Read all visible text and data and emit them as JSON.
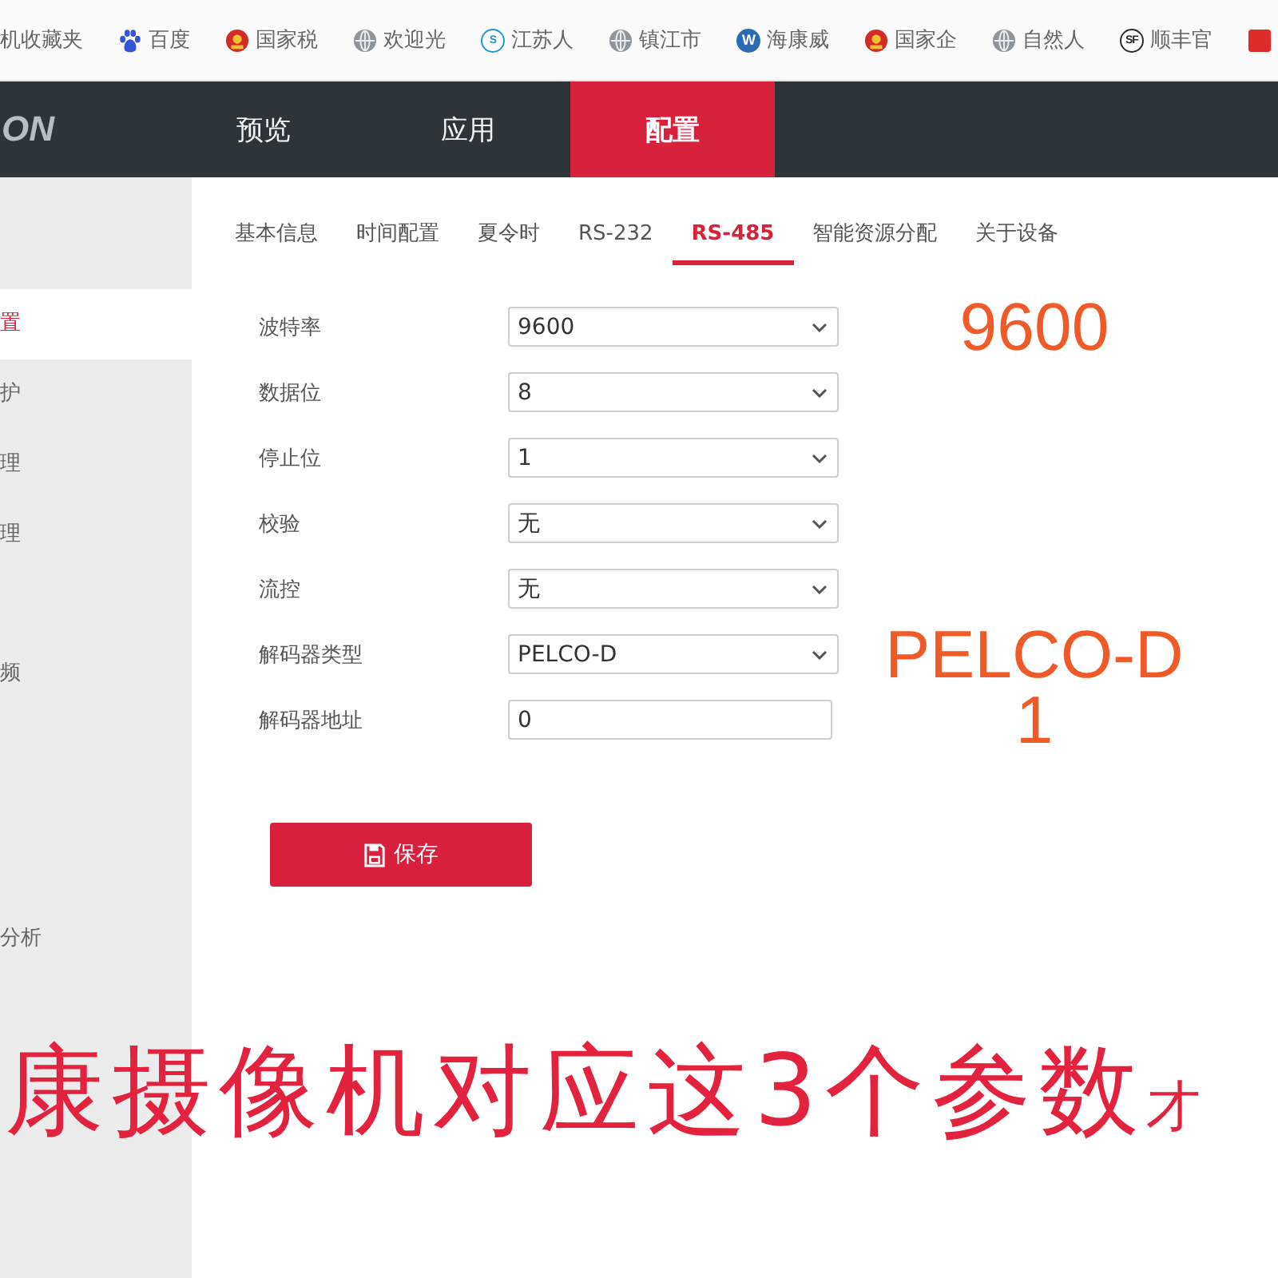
{
  "bookmarks": [
    {
      "kind": "plain",
      "label": "机收藏夹"
    },
    {
      "kind": "paw",
      "label": "百度"
    },
    {
      "kind": "emblem",
      "label": "国家税"
    },
    {
      "kind": "globe",
      "label": "欢迎光"
    },
    {
      "kind": "ring",
      "badge": "S",
      "color": "#1d9ad6",
      "label": "江苏人"
    },
    {
      "kind": "globe",
      "label": "镇江市"
    },
    {
      "kind": "disc",
      "badge": "W",
      "color": "#2b6cb0",
      "label": "海康威"
    },
    {
      "kind": "emblem",
      "label": "国家企"
    },
    {
      "kind": "globe",
      "label": "自然人"
    },
    {
      "kind": "ring",
      "badge": "SF",
      "color": "#2a2a2a",
      "label": "顺丰官"
    },
    {
      "kind": "tile"
    }
  ],
  "nav": {
    "logo": "ON",
    "items": [
      {
        "label": "预览",
        "selected": false
      },
      {
        "label": "应用",
        "selected": false
      },
      {
        "label": "配置",
        "selected": true
      }
    ]
  },
  "tabs": [
    {
      "label": "基本信息",
      "selected": false
    },
    {
      "label": "时间配置",
      "selected": false
    },
    {
      "label": "夏令时",
      "selected": false
    },
    {
      "label": "RS-232",
      "selected": false
    },
    {
      "label": "RS-485",
      "selected": true
    },
    {
      "label": "智能资源分配",
      "selected": false
    },
    {
      "label": "关于设备",
      "selected": false
    }
  ],
  "sidebar": {
    "groups": [
      {
        "items": [
          {
            "label": "置",
            "selected": true
          },
          {
            "label": "护",
            "selected": false
          },
          {
            "label": "理",
            "selected": false
          },
          {
            "label": "理",
            "selected": false
          }
        ]
      },
      {
        "items": [
          {
            "label": "频",
            "selected": false
          }
        ]
      },
      {
        "items": [
          {
            "label": "分析",
            "selected": false
          }
        ]
      }
    ]
  },
  "form": {
    "fields": [
      {
        "kind": "select",
        "label": "波特率",
        "value": "9600",
        "annotation": "9600"
      },
      {
        "kind": "select",
        "label": "数据位",
        "value": "8"
      },
      {
        "kind": "select",
        "label": "停止位",
        "value": "1"
      },
      {
        "kind": "select",
        "label": "校验",
        "value": "无"
      },
      {
        "kind": "select",
        "label": "流控",
        "value": "无"
      },
      {
        "kind": "select",
        "label": "解码器类型",
        "value": "PELCO-D",
        "annotation": "PELCO-D"
      },
      {
        "kind": "input",
        "label": "解码器地址",
        "value": "0",
        "annotation": "1"
      }
    ],
    "save_button": "保存"
  },
  "caption": {
    "text": "康摄像机对应这3个参数",
    "small_tail": "才"
  }
}
